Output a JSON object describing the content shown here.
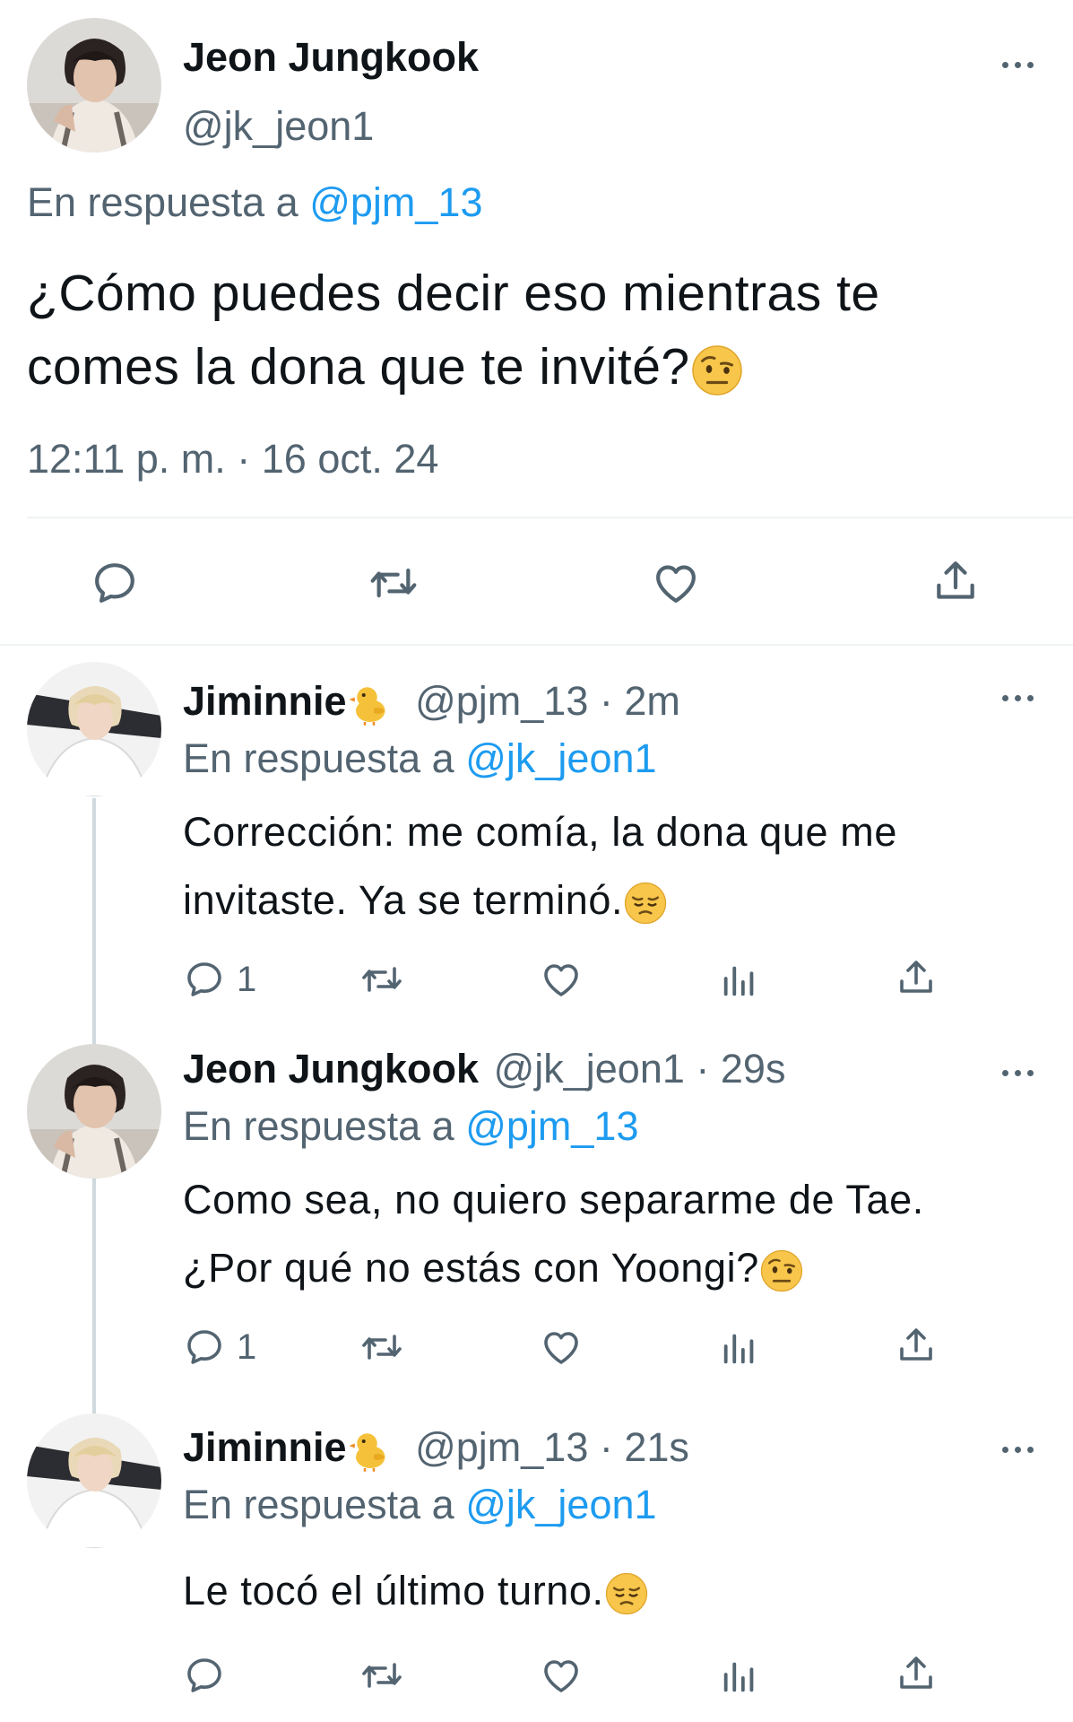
{
  "main_tweet": {
    "display_name": "Jeon Jungkook",
    "handle": "@jk_jeon1",
    "reply_prefix": "En respuesta a",
    "reply_to": "@pjm_13",
    "text_line1": "¿Cómo puedes decir eso mientras te",
    "text_line2": "comes la dona que te invité?",
    "emoji": "face-with-raised-eyebrow",
    "timestamp": "12:11 p. m. · 16 oct. 24"
  },
  "replies": [
    {
      "display_name": "Jiminnie",
      "name_emoji": "baby-chick",
      "handle": "@pjm_13",
      "age": "· 2m",
      "reply_prefix": "En respuesta a",
      "reply_to": "@jk_jeon1",
      "text_line1": "Corrección: me comía, la dona que me",
      "text_line2": "invitaste. Ya se terminó.",
      "emoji": "pensive-face",
      "reply_count": "1"
    },
    {
      "display_name": "Jeon Jungkook",
      "handle": "@jk_jeon1",
      "age": "· 29s",
      "reply_prefix": "En respuesta a",
      "reply_to": "@pjm_13",
      "text_line1": "Como sea, no quiero separarme de Tae.",
      "text_line2": "¿Por qué no estás con Yoongi?",
      "emoji": "face-with-raised-eyebrow",
      "reply_count": "1"
    },
    {
      "display_name": "Jiminnie",
      "name_emoji": "baby-chick",
      "handle": "@pjm_13",
      "age": "· 21s",
      "reply_prefix": "En respuesta a",
      "reply_to": "@jk_jeon1",
      "text_line1": "Le tocó el último turno.",
      "emoji": "pensive-face"
    }
  ],
  "colors": {
    "text": "#0f1419",
    "secondary": "#536471",
    "accent": "#1d9bf0",
    "divider": "#eff3f4",
    "thread_line": "#cfd9de"
  }
}
